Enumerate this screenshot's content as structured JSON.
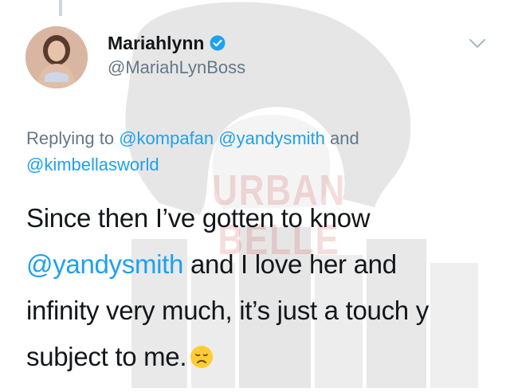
{
  "author": {
    "display_name": "Mariahlynn",
    "handle": "@MariahLynBoss"
  },
  "reply": {
    "prefix": "Replying to",
    "mention_1": "@kompafan",
    "mention_2": "@yandysmith",
    "conjunction": "and",
    "mention_3": "@kimbellasworld"
  },
  "tweet": {
    "line1": "Since then I’ve gotten to know",
    "mention": "@yandysmith",
    "line2_rest": " and I love her and",
    "line3": "infinity very much, it’s just a touch y",
    "line4": "subject to me."
  },
  "watermark": {
    "text": "URBAN BELLE"
  },
  "icons": {
    "verified": "verified-badge-icon",
    "menu": "chevron-down-icon",
    "emoji": "disappointed-face-emoji"
  },
  "colors": {
    "link": "#1da1f2",
    "secondary_text": "#657786",
    "primary_text": "#14171a",
    "thread_line": "#ccd6dd"
  }
}
